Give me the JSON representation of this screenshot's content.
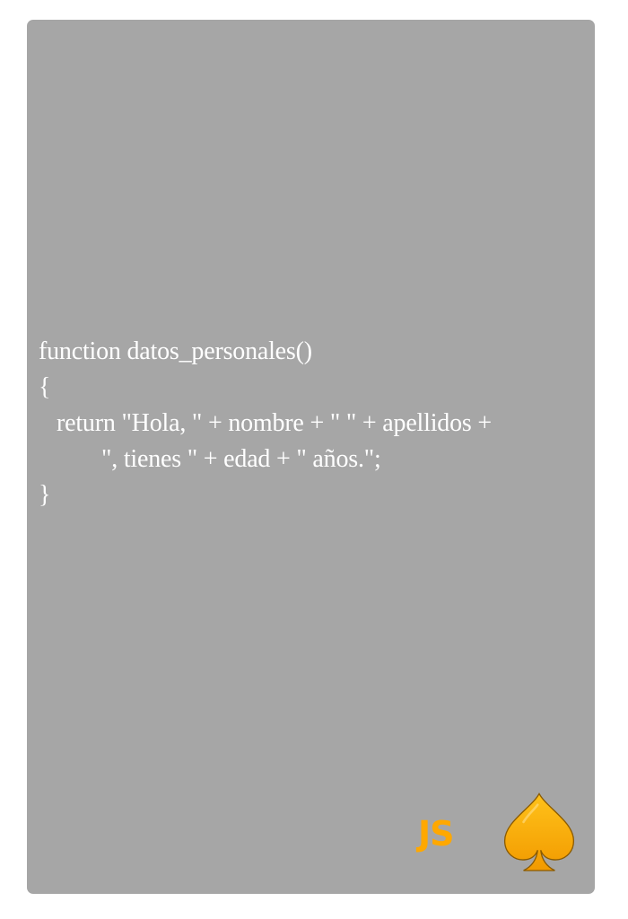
{
  "card": {
    "background": "#a6a6a6"
  },
  "code": {
    "lines": [
      "function datos_personales()",
      "{",
      "return \"Hola, \" + nombre + \" \" + apellidos +",
      "\", tienes \" + edad + \" años.\";",
      "}"
    ]
  },
  "brand": {
    "label": "JS",
    "icon": "spade-icon",
    "color": "#ffa800"
  }
}
